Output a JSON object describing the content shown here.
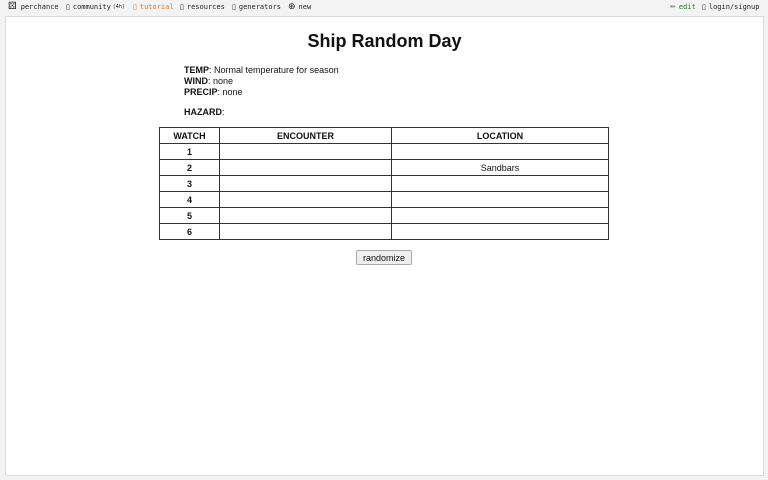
{
  "nav": {
    "perchance": "perchance",
    "community": "community",
    "community_badge": "(4h)",
    "tutorial": "tutorial",
    "resources": "resources",
    "generators": "generators",
    "new": "new",
    "edit": "edit",
    "login": "login/signup",
    "icons": {
      "perchance": "die-icon",
      "community": "chat-icon",
      "tutorial": "book-icon",
      "resources": "folder-icon",
      "generators": "list-icon",
      "new": "plus-circle-icon",
      "edit": "pencil-icon",
      "login": "user-icon"
    },
    "colors": {
      "tutorial": "#d9742c",
      "edit": "#2a7a2a"
    }
  },
  "page": {
    "title": "Ship Random Day",
    "temp_label": "TEMP",
    "temp_value": "Normal temperature for season",
    "wind_label": "WIND",
    "wind_value": "none",
    "precip_label": "PRECIP",
    "precip_value": "none",
    "hazard_label": "HAZARD",
    "hazard_value": ""
  },
  "table": {
    "headers": [
      "WATCH",
      "ENCOUNTER",
      "LOCATION"
    ],
    "rows": [
      {
        "watch": "1",
        "encounter": "",
        "location": ""
      },
      {
        "watch": "2",
        "encounter": "",
        "location": "Sandbars"
      },
      {
        "watch": "3",
        "encounter": "",
        "location": ""
      },
      {
        "watch": "4",
        "encounter": "",
        "location": ""
      },
      {
        "watch": "5",
        "encounter": "",
        "location": ""
      },
      {
        "watch": "6",
        "encounter": "",
        "location": ""
      }
    ]
  },
  "randomize_label": "randomize"
}
